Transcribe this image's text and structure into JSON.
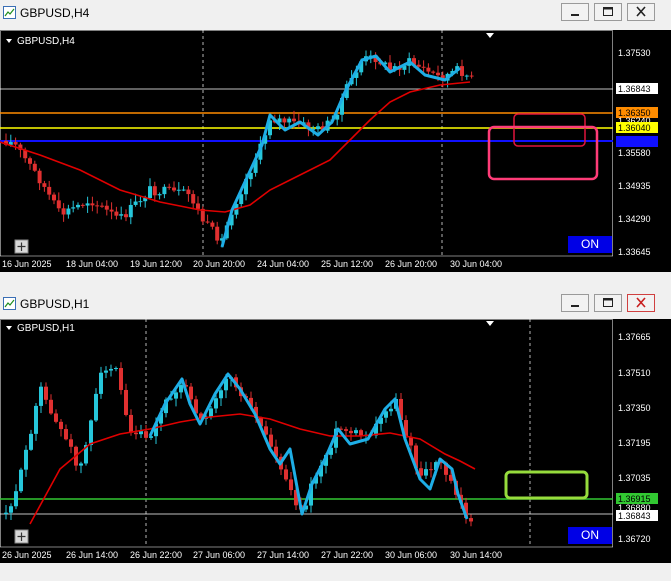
{
  "windows": [
    {
      "title": "GBPUSD,H4",
      "chart_label": "GBPUSD,H4",
      "on_label": "ON",
      "price_labels": [
        "1.37530",
        "1.36843",
        "1.36350",
        "1.36240",
        "1.36040",
        "1.35580",
        "1.34935",
        "1.34290",
        "1.33645"
      ],
      "date_labels": [
        "16 Jun 2025",
        "18 Jun 04:00",
        "19 Jun 12:00",
        "20 Jun 20:00",
        "24 Jun 04:00",
        "25 Jun 12:00",
        "26 Jun 20:00",
        "30 Jun 04:00"
      ],
      "colors": {
        "bid_line": "#ffffff",
        "orange_line": "#ff8c00",
        "yellow_line": "#ffff00",
        "blue_line": "#1010ff",
        "ma_line": "#e00000",
        "zigzag": "#1eaee6",
        "box_red": "#e0143c",
        "box_pink": "#ff3c78"
      }
    },
    {
      "title": "GBPUSD,H1",
      "chart_label": "GBPUSD,H1",
      "on_label": "ON",
      "price_labels": [
        "1.37665",
        "1.37510",
        "1.37350",
        "1.37195",
        "1.37035",
        "1.36915",
        "1.36880",
        "1.36843",
        "1.36720"
      ],
      "date_labels": [
        "26 Jun 2025",
        "26 Jun 14:00",
        "26 Jun 22:00",
        "27 Jun 06:00",
        "27 Jun 14:00",
        "27 Jun 22:00",
        "30 Jun 06:00",
        "30 Jun 14:00"
      ],
      "colors": {
        "bid_line": "#ffffff",
        "green_line": "#32c832",
        "ma_line": "#e00000",
        "zigzag": "#1eaee6",
        "box_green": "#96dc3c"
      }
    }
  ]
}
